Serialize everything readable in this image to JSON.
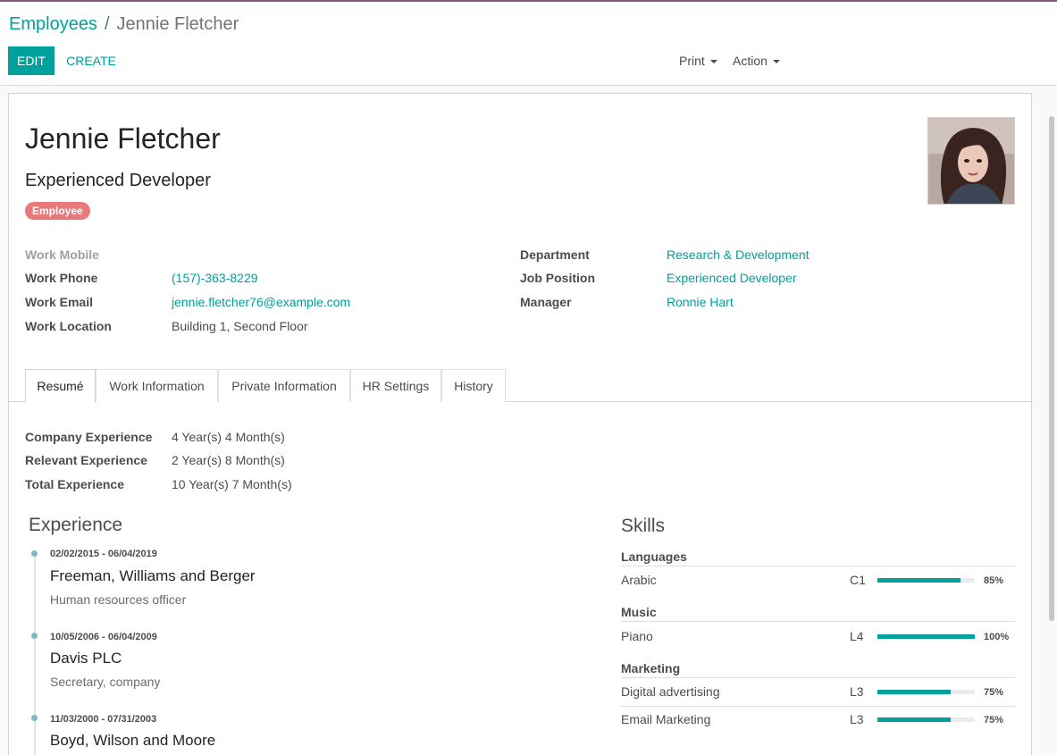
{
  "breadcrumb": {
    "parent": "Employees",
    "separator": "/",
    "current": "Jennie Fletcher"
  },
  "toolbar": {
    "edit_label": "EDIT",
    "create_label": "CREATE",
    "print_label": "Print",
    "action_label": "Action"
  },
  "colors": {
    "accent": "#00a09d",
    "tag": "#e8787a",
    "top_bar": "#875a7b"
  },
  "employee": {
    "name": "Jennie Fletcher",
    "job_title": "Experienced Developer",
    "tag": "Employee"
  },
  "fields_left": [
    {
      "label": "Work Mobile",
      "value": ""
    },
    {
      "label": "Work Phone",
      "value": "(157)-363-8229"
    },
    {
      "label": "Work Email",
      "value": "jennie.fletcher76@example.com"
    },
    {
      "label": "Work Location",
      "value": "Building 1, Second Floor"
    }
  ],
  "fields_right": [
    {
      "label": "Department",
      "value": "Research & Development"
    },
    {
      "label": "Job Position",
      "value": "Experienced Developer"
    },
    {
      "label": "Manager",
      "value": "Ronnie Hart"
    }
  ],
  "tabs": [
    "Resumé",
    "Work Information",
    "Private Information",
    "HR Settings",
    "History"
  ],
  "experience_summary": [
    {
      "label": "Company Experience",
      "value": "4 Year(s) 4 Month(s)"
    },
    {
      "label": "Relevant Experience",
      "value": "2 Year(s) 8 Month(s)"
    },
    {
      "label": "Total Experience",
      "value": "10 Year(s) 7 Month(s)"
    }
  ],
  "experience": {
    "title": "Experience",
    "items": [
      {
        "dates": "02/02/2015 - 06/04/2019",
        "company": "Freeman, Williams and Berger",
        "description": "Human resources officer"
      },
      {
        "dates": "10/05/2006 - 06/04/2009",
        "company": "Davis PLC",
        "description": "Secretary, company"
      },
      {
        "dates": "11/03/2000 - 07/31/2003",
        "company": "Boyd, Wilson and Moore",
        "description": ""
      }
    ]
  },
  "skills": {
    "title": "Skills",
    "groups": [
      {
        "name": "Languages",
        "skills": [
          {
            "name": "Arabic",
            "level": "C1",
            "progress": 85,
            "percent_label": "85%"
          }
        ]
      },
      {
        "name": "Music",
        "skills": [
          {
            "name": "Piano",
            "level": "L4",
            "progress": 100,
            "percent_label": "100%"
          }
        ]
      },
      {
        "name": "Marketing",
        "skills": [
          {
            "name": "Digital advertising",
            "level": "L3",
            "progress": 75,
            "percent_label": "75%"
          },
          {
            "name": "Email Marketing",
            "level": "L3",
            "progress": 75,
            "percent_label": "75%"
          }
        ]
      }
    ]
  }
}
